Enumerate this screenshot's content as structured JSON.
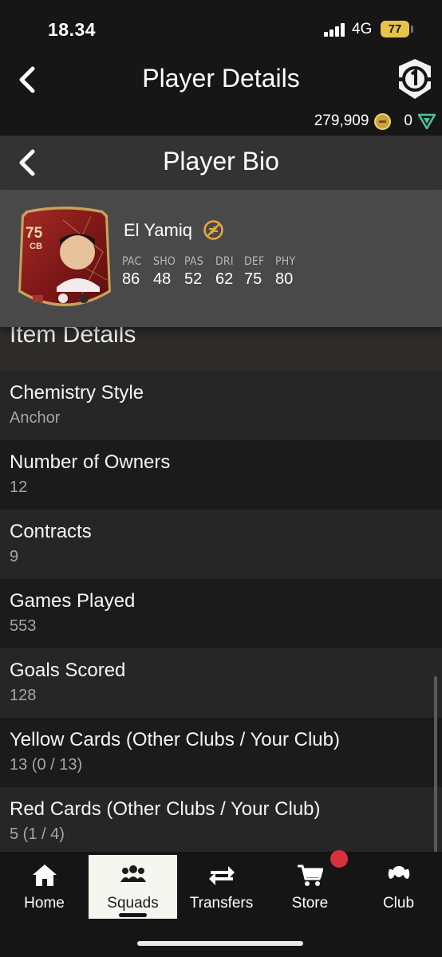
{
  "status_bar": {
    "time": "18.34",
    "network": "4G",
    "battery": "77"
  },
  "header": {
    "title": "Player Details",
    "coins": "279,909",
    "points": "0"
  },
  "sub_header": {
    "title": "Player Bio"
  },
  "player": {
    "name": "El Yamiq",
    "rating": "75",
    "position": "CB",
    "stats": [
      {
        "label": "PAC",
        "value": "86"
      },
      {
        "label": "SHO",
        "value": "48"
      },
      {
        "label": "PAS",
        "value": "52"
      },
      {
        "label": "DRI",
        "value": "62"
      },
      {
        "label": "DEF",
        "value": "75"
      },
      {
        "label": "PHY",
        "value": "80"
      }
    ]
  },
  "section": {
    "title": "Item Details"
  },
  "details": [
    {
      "label": "Chemistry Style",
      "value": "Anchor"
    },
    {
      "label": "Number of Owners",
      "value": "12"
    },
    {
      "label": "Contracts",
      "value": "9"
    },
    {
      "label": "Games Played",
      "value": "553"
    },
    {
      "label": "Goals Scored",
      "value": "128"
    },
    {
      "label": "Yellow Cards (Other Clubs / Your Club)",
      "value": "13 (0 / 13)"
    },
    {
      "label": "Red Cards (Other Clubs / Your Club)",
      "value": "5 (1 / 4)"
    }
  ],
  "tabs": [
    {
      "label": "Home",
      "icon": "home-icon"
    },
    {
      "label": "Squads",
      "icon": "squads-icon",
      "active": true
    },
    {
      "label": "Transfers",
      "icon": "transfers-icon"
    },
    {
      "label": "Store",
      "icon": "store-icon",
      "badge": true
    },
    {
      "label": "Club",
      "icon": "club-icon"
    }
  ],
  "colors": {
    "card_red": "#8e1c1c",
    "card_gold": "#c9a25a",
    "badge_red": "#d8313c",
    "coin_gold": "#c9a23b"
  }
}
